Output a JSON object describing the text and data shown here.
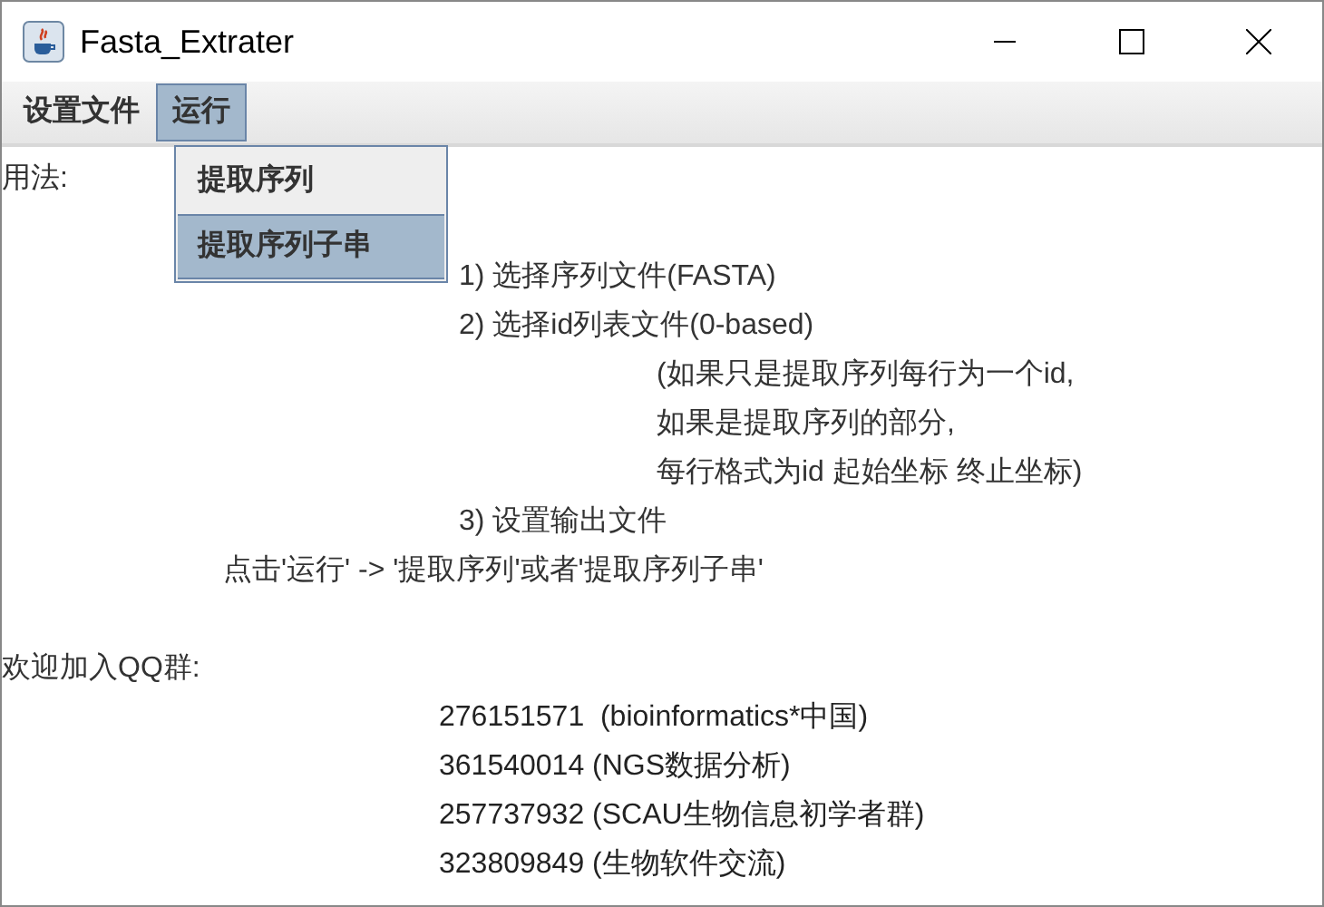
{
  "window": {
    "title": "Fasta_Extrater"
  },
  "menu": [
    {
      "label": "设置文件",
      "selected": false
    },
    {
      "label": "运行",
      "selected": true
    }
  ],
  "dropdown": [
    {
      "label": "提取序列",
      "selected": false
    },
    {
      "label": "提取序列子串",
      "selected": true
    }
  ],
  "lines": [
    {
      "kind": "heading",
      "text": "用法:"
    },
    {
      "kind": "blank"
    },
    {
      "kind": "step",
      "text": "1) 选择序列文件(FASTA)"
    },
    {
      "kind": "step",
      "text": "2) 选择id列表文件(0-based)"
    },
    {
      "kind": "note",
      "text": "(如果只是提取序列每行为一个id,"
    },
    {
      "kind": "note",
      "text": "如果是提取序列的部分,"
    },
    {
      "kind": "note",
      "text": "每行格式为id 起始坐标 终止坐标)"
    },
    {
      "kind": "step",
      "text": "3) 设置输出文件"
    },
    {
      "kind": "hint",
      "text": "点击'运行' -> '提取序列'或者'提取序列子串'"
    },
    {
      "kind": "blank"
    },
    {
      "kind": "heading",
      "text": "欢迎加入QQ群:"
    },
    {
      "kind": "group",
      "text": "276151571  (bioinformatics*中国)"
    },
    {
      "kind": "group",
      "text": "361540014 (NGS数据分析)"
    },
    {
      "kind": "group",
      "text": "257737932 (SCAU生物信息初学者群)"
    },
    {
      "kind": "group",
      "text": "323809849 (生物软件交流)"
    }
  ]
}
